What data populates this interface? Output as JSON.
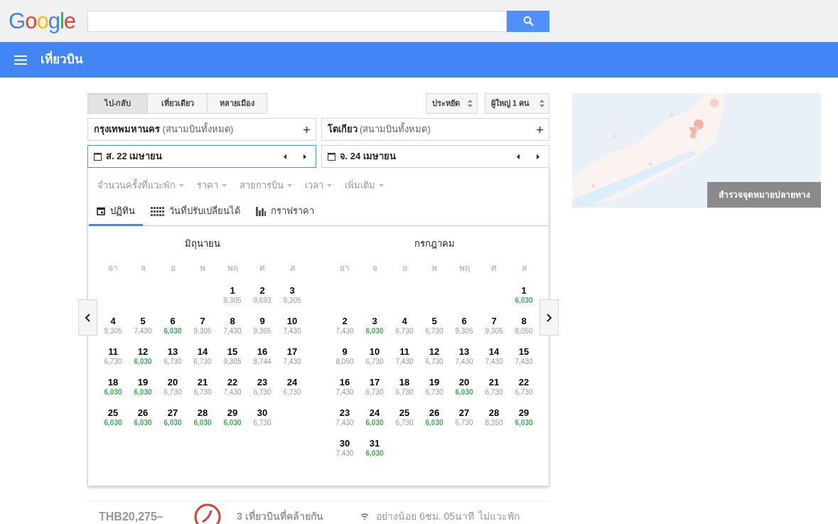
{
  "logo": "Google",
  "app_bar": {
    "title": "เที่ยวบิน"
  },
  "trip_types": [
    {
      "label": "ไป-กลับ",
      "selected": true
    },
    {
      "label": "เที่ยวเดียว",
      "selected": false
    },
    {
      "label": "หลายเมือง",
      "selected": false
    }
  ],
  "cabin": "ประหยัด",
  "passengers": "ผู้ใหญ่ 1 คน",
  "origin": {
    "city": "กรุงเทพมหานคร",
    "note": "(สนามบินทั้งหมด)"
  },
  "destination": {
    "city": "โตเกียว",
    "note": "(สนามบินทั้งหมด)"
  },
  "dates": [
    {
      "value": "ส. 22 เมษายน",
      "focused": true
    },
    {
      "value": "จ. 24 เมษายน",
      "focused": false
    }
  ],
  "filters": [
    "จำนวนครั้งที่แวะพัก",
    "ราคา",
    "สายการบิน",
    "เวลา",
    "เพิ่มเติม"
  ],
  "view_tabs": [
    {
      "kind": "calendar",
      "label": "ปฏิทิน",
      "selected": true
    },
    {
      "kind": "grid",
      "label": "วันที่ปรับเปลี่ยนได้",
      "selected": false
    },
    {
      "kind": "chart",
      "label": "กราฟราคา",
      "selected": false
    }
  ],
  "months": [
    {
      "name": "มิถุนายน",
      "weekdays": [
        "อา",
        "จ",
        "อ",
        "พ",
        "พฤ",
        "ศ",
        "ส"
      ],
      "days": [
        {
          "kind": "blank"
        },
        {
          "kind": "blank"
        },
        {
          "kind": "blank"
        },
        {
          "kind": "blank"
        },
        {
          "kind": "day",
          "day": "1",
          "price": "9,305",
          "cheapest": false
        },
        {
          "kind": "day",
          "day": "2",
          "price": "9,693",
          "cheapest": false
        },
        {
          "kind": "day",
          "day": "3",
          "price": "9,305",
          "cheapest": false
        },
        {
          "kind": "day",
          "day": "4",
          "price": "9,305",
          "cheapest": false
        },
        {
          "kind": "day",
          "day": "5",
          "price": "7,430",
          "cheapest": false
        },
        {
          "kind": "day",
          "day": "6",
          "price": "6,030",
          "cheapest": true
        },
        {
          "kind": "day",
          "day": "7",
          "price": "9,305",
          "cheapest": false
        },
        {
          "kind": "day",
          "day": "8",
          "price": "7,430",
          "cheapest": false
        },
        {
          "kind": "day",
          "day": "9",
          "price": "9,305",
          "cheapest": false
        },
        {
          "kind": "day",
          "day": "10",
          "price": "7,430",
          "cheapest": false
        },
        {
          "kind": "day",
          "day": "11",
          "price": "6,730",
          "cheapest": false
        },
        {
          "kind": "day",
          "day": "12",
          "price": "6,030",
          "cheapest": true
        },
        {
          "kind": "day",
          "day": "13",
          "price": "6,730",
          "cheapest": false
        },
        {
          "kind": "day",
          "day": "14",
          "price": "6,730",
          "cheapest": false
        },
        {
          "kind": "day",
          "day": "15",
          "price": "9,305",
          "cheapest": false
        },
        {
          "kind": "day",
          "day": "16",
          "price": "8,744",
          "cheapest": false
        },
        {
          "kind": "day",
          "day": "17",
          "price": "7,430",
          "cheapest": false
        },
        {
          "kind": "day",
          "day": "18",
          "price": "6,030",
          "cheapest": true
        },
        {
          "kind": "day",
          "day": "19",
          "price": "6,030",
          "cheapest": true
        },
        {
          "kind": "day",
          "day": "20",
          "price": "6,730",
          "cheapest": false
        },
        {
          "kind": "day",
          "day": "21",
          "price": "6,730",
          "cheapest": false
        },
        {
          "kind": "day",
          "day": "22",
          "price": "7,430",
          "cheapest": false
        },
        {
          "kind": "day",
          "day": "23",
          "price": "6,730",
          "cheapest": false
        },
        {
          "kind": "day",
          "day": "24",
          "price": "6,730",
          "cheapest": false
        },
        {
          "kind": "day",
          "day": "25",
          "price": "6,030",
          "cheapest": true
        },
        {
          "kind": "day",
          "day": "26",
          "price": "6,030",
          "cheapest": true
        },
        {
          "kind": "day",
          "day": "27",
          "price": "6,030",
          "cheapest": true
        },
        {
          "kind": "day",
          "day": "28",
          "price": "6,030",
          "cheapest": true
        },
        {
          "kind": "day",
          "day": "29",
          "price": "6,030",
          "cheapest": true
        },
        {
          "kind": "day",
          "day": "30",
          "price": "6,730",
          "cheapest": false
        }
      ]
    },
    {
      "name": "กรกฎาคม",
      "weekdays": [
        "อา",
        "จ",
        "อ",
        "พ",
        "พฤ",
        "ศ",
        "ส"
      ],
      "days": [
        {
          "kind": "blank"
        },
        {
          "kind": "blank"
        },
        {
          "kind": "blank"
        },
        {
          "kind": "blank"
        },
        {
          "kind": "blank"
        },
        {
          "kind": "blank"
        },
        {
          "kind": "day",
          "day": "1",
          "price": "6,030",
          "cheapest": true
        },
        {
          "kind": "day",
          "day": "2",
          "price": "7,430",
          "cheapest": false
        },
        {
          "kind": "day",
          "day": "3",
          "price": "6,030",
          "cheapest": true
        },
        {
          "kind": "day",
          "day": "4",
          "price": "6,730",
          "cheapest": false
        },
        {
          "kind": "day",
          "day": "5",
          "price": "6,730",
          "cheapest": false
        },
        {
          "kind": "day",
          "day": "6",
          "price": "9,305",
          "cheapest": false
        },
        {
          "kind": "day",
          "day": "7",
          "price": "9,305",
          "cheapest": false
        },
        {
          "kind": "day",
          "day": "8",
          "price": "8,050",
          "cheapest": false
        },
        {
          "kind": "day",
          "day": "9",
          "price": "8,050",
          "cheapest": false
        },
        {
          "kind": "day",
          "day": "10",
          "price": "6,730",
          "cheapest": false
        },
        {
          "kind": "day",
          "day": "11",
          "price": "7,430",
          "cheapest": false
        },
        {
          "kind": "day",
          "day": "12",
          "price": "6,730",
          "cheapest": false
        },
        {
          "kind": "day",
          "day": "13",
          "price": "7,430",
          "cheapest": false
        },
        {
          "kind": "day",
          "day": "14",
          "price": "7,430",
          "cheapest": false
        },
        {
          "kind": "day",
          "day": "15",
          "price": "7,430",
          "cheapest": false
        },
        {
          "kind": "day",
          "day": "16",
          "price": "7,430",
          "cheapest": false
        },
        {
          "kind": "day",
          "day": "17",
          "price": "6,730",
          "cheapest": false
        },
        {
          "kind": "day",
          "day": "18",
          "price": "6,730",
          "cheapest": false
        },
        {
          "kind": "day",
          "day": "19",
          "price": "6,730",
          "cheapest": false
        },
        {
          "kind": "day",
          "day": "20",
          "price": "6,030",
          "cheapest": true
        },
        {
          "kind": "day",
          "day": "21",
          "price": "6,730",
          "cheapest": false
        },
        {
          "kind": "day",
          "day": "22",
          "price": "6,730",
          "cheapest": false
        },
        {
          "kind": "day",
          "day": "23",
          "price": "7,430",
          "cheapest": false
        },
        {
          "kind": "day",
          "day": "24",
          "price": "6,030",
          "cheapest": true
        },
        {
          "kind": "day",
          "day": "25",
          "price": "6,730",
          "cheapest": false
        },
        {
          "kind": "day",
          "day": "26",
          "price": "6,030",
          "cheapest": true
        },
        {
          "kind": "day",
          "day": "27",
          "price": "6,730",
          "cheapest": false
        },
        {
          "kind": "day",
          "day": "28",
          "price": "8,350",
          "cheapest": false
        },
        {
          "kind": "day",
          "day": "29",
          "price": "6,030",
          "cheapest": true
        },
        {
          "kind": "day",
          "day": "30",
          "price": "7,430",
          "cheapest": false
        },
        {
          "kind": "day",
          "day": "31",
          "price": "6,030",
          "cheapest": true
        }
      ]
    }
  ],
  "map": {
    "kind": "picture",
    "button": "สำรวจจุดหมายปลายทาง"
  },
  "result": {
    "price": "THB20,275–",
    "similar": "3 เที่ยวบินที่คล้ายกัน",
    "duration": "อย่างน้อย 6ชม. 05นาที",
    "stops": "ไม่แวะพัก"
  }
}
